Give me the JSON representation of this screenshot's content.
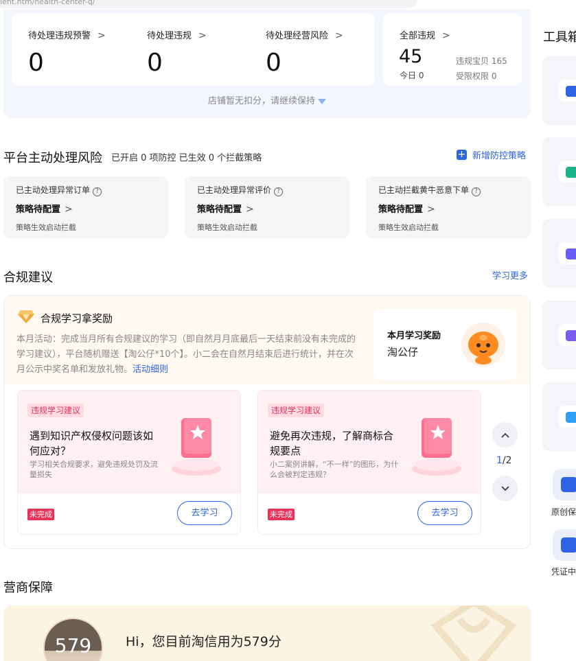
{
  "browser": {
    "url_fragment": "ient.htm/health-center-q/"
  },
  "stats": {
    "pending_warning": {
      "label": "待处理违规预警",
      "value": "0"
    },
    "pending_violation": {
      "label": "待处理违规",
      "value": "0"
    },
    "pending_risk": {
      "label": "待处理经营风险",
      "value": "0"
    },
    "all": {
      "label": "全部违规",
      "value": "45",
      "today": "今日 0",
      "items_label": "违规宝贝 165",
      "restricted_label": "受限权限 0"
    },
    "tip": "店铺暂无扣分，请继续保持"
  },
  "platform_risk": {
    "title": "平台主动处理风险",
    "subtitle": "已开启 0 项防控 已生效 0 个拦截策略",
    "add_label": "新增防控策略",
    "cards": [
      {
        "title": "已主动处理异常订单",
        "status": "策略待配置",
        "desc": "策略生效启动拦截"
      },
      {
        "title": "已主动处理异常评价",
        "status": "策略待配置",
        "desc": "策略生效启动拦截"
      },
      {
        "title": "已主动拦截黄牛恶意下单",
        "status": "策略待配置",
        "desc": "策略生效启动拦截"
      }
    ]
  },
  "compliance": {
    "title": "合规建议",
    "learn_more": "学习更多",
    "reward_heading": "合规学习拿奖励",
    "activity_text": "本月活动：完成当月所有合规建议的学习（即自然月月底最后一天结束前没有未完成的学习建议），平台随机赠送【淘公仔*10个】。小二会在自然月结束后进行统计，并在次月公示中奖名单和发放礼物。",
    "activity_link": "活动细则",
    "reward_title": "本月学习奖励",
    "reward_name": "淘公仔",
    "cards": [
      {
        "tag": "违规学习建议",
        "title": "遇到知识产权侵权问题该如何应对？",
        "desc": "学习相关合规要求，避免违规处罚及流量损失",
        "badge": "未完成",
        "button": "去学习"
      },
      {
        "tag": "违规学习建议",
        "title": "避免再次违规，了解商标合规要点",
        "desc": "小二案例讲解，“不一样”的图形，为什么会被判定违规？",
        "badge": "未完成",
        "button": "去学习"
      }
    ],
    "pager": {
      "current": "1",
      "total": "/2"
    }
  },
  "guarantee": {
    "title": "营商保障",
    "score": "579",
    "text": "Hi，您目前淘信用为579分"
  },
  "toolbox": {
    "title": "工具箱",
    "colors": [
      "#2e63e6",
      "#19b48a",
      "#6a5cf6",
      "#7a5cf0",
      "#2f9ff5"
    ],
    "small_items": [
      {
        "label": "原创保",
        "icon": "shield-icon"
      },
      {
        "label": "凭证中",
        "icon": "certificate-icon"
      }
    ]
  }
}
